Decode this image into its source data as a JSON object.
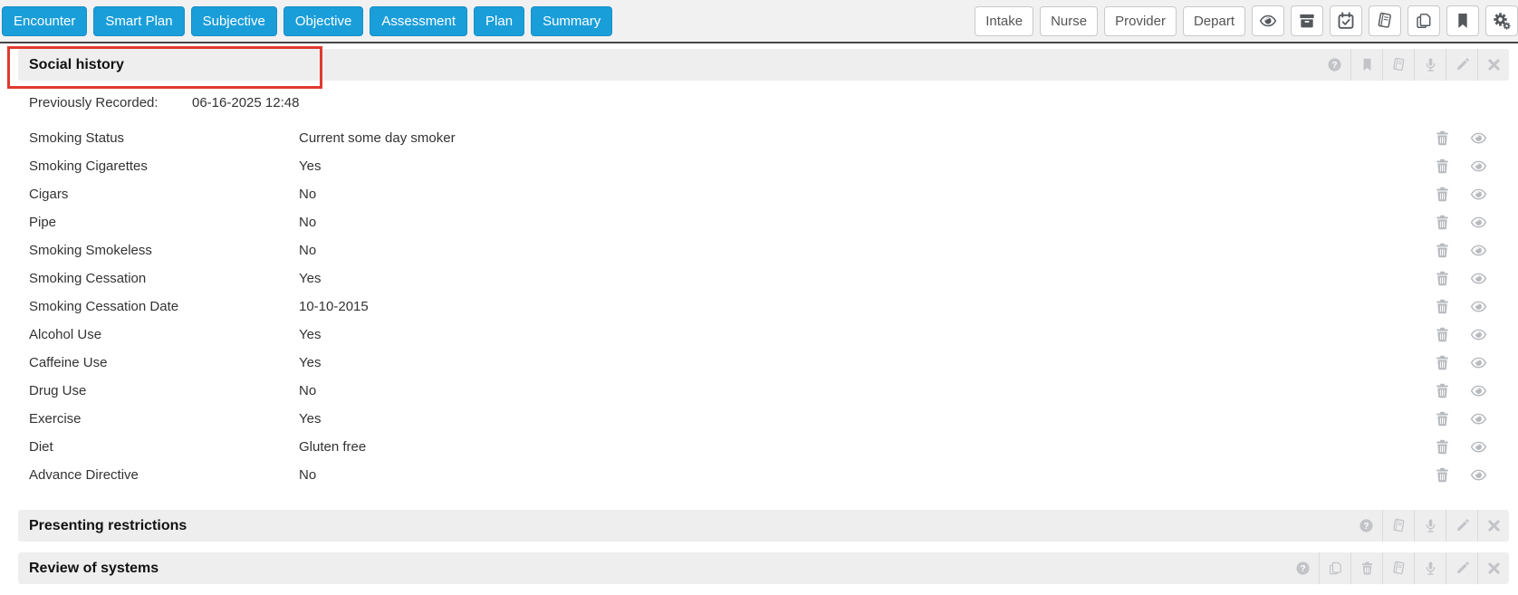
{
  "toolbar": {
    "nav_buttons": [
      "Encounter",
      "Smart Plan",
      "Subjective",
      "Objective",
      "Assessment",
      "Plan",
      "Summary"
    ],
    "stage_buttons": [
      "Intake",
      "Nurse",
      "Provider",
      "Depart"
    ],
    "icon_buttons": [
      "eye-icon",
      "archive-icon",
      "calendar-check-icon",
      "book-icon",
      "copy-icon",
      "bookmark-icon",
      "gears-icon"
    ]
  },
  "colors": {
    "nav_blue": "#1a9ed9",
    "annotation_red": "#e0392f",
    "section_bar_bg": "#eeeeef",
    "section_icon_gray": "#c2c4c8",
    "row_icon_gray": "#b6b9bd",
    "toolbar_icon_dark": "#54585c"
  },
  "social_history": {
    "title": "Social history",
    "toolbar_icons": [
      "help-icon",
      "bookmark-icon",
      "book-icon",
      "mic-icon",
      "pencil-icon",
      "close-icon"
    ],
    "previously_recorded": {
      "label": "Previously Recorded:",
      "value": "06-16-2025 12:48"
    },
    "row_action_icons": [
      "trash-icon",
      "eye-icon"
    ],
    "rows": [
      {
        "label": "Smoking Status",
        "value": "Current some day smoker"
      },
      {
        "label": "Smoking Cigarettes",
        "value": "Yes"
      },
      {
        "label": "Cigars",
        "value": "No"
      },
      {
        "label": "Pipe",
        "value": "No"
      },
      {
        "label": "Smoking Smokeless",
        "value": "No"
      },
      {
        "label": "Smoking Cessation",
        "value": "Yes"
      },
      {
        "label": "Smoking Cessation Date",
        "value": "10-10-2015"
      },
      {
        "label": "Alcohol Use",
        "value": "Yes"
      },
      {
        "label": "Caffeine Use",
        "value": "Yes"
      },
      {
        "label": "Drug Use",
        "value": "No"
      },
      {
        "label": "Exercise",
        "value": "Yes"
      },
      {
        "label": "Diet",
        "value": "Gluten free"
      },
      {
        "label": "Advance Directive",
        "value": "No"
      }
    ]
  },
  "presenting_restrictions": {
    "title": "Presenting restrictions",
    "toolbar_icons": [
      "help-icon",
      "book-icon",
      "mic-icon",
      "pencil-icon",
      "close-icon"
    ]
  },
  "review_of_systems": {
    "title": "Review of systems",
    "toolbar_icons": [
      "help-icon",
      "copy-icon",
      "trash-icon",
      "book-icon",
      "mic-icon",
      "pencil-icon",
      "close-icon"
    ]
  }
}
